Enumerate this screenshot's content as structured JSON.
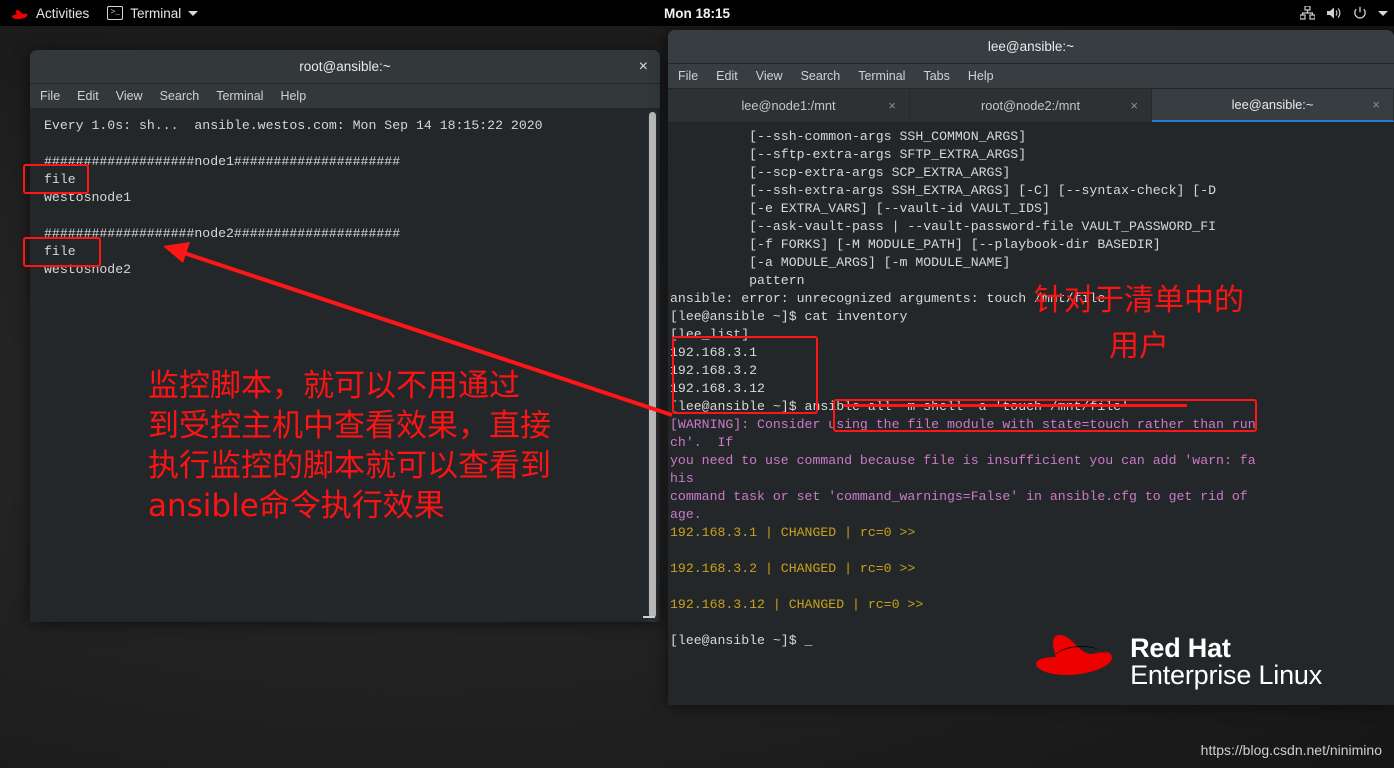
{
  "topbar": {
    "activities": "Activities",
    "app_menu": "Terminal",
    "clock": "Mon 18:15",
    "icons": [
      "redhat-logo-icon",
      "terminal-icon",
      "chevron-down-icon",
      "network-icon",
      "volume-icon",
      "power-icon",
      "system-menu-caret-icon"
    ]
  },
  "left_window": {
    "title": "root@ansible:~",
    "close_label": "×",
    "menu": [
      "File",
      "Edit",
      "View",
      "Search",
      "Terminal",
      "Help"
    ],
    "lines": [
      "Every 1.0s: sh...  ansible.westos.com: Mon Sep 14 18:15:22 2020",
      "",
      "###################node1#####################",
      "file",
      "westosnode1",
      "",
      "###################node2#####################",
      "file",
      "westosnode2"
    ],
    "annotation_boxes": [
      "file-node1-box",
      "file-node2-box"
    ]
  },
  "right_window": {
    "title": "lee@ansible:~",
    "menu": [
      "File",
      "Edit",
      "View",
      "Search",
      "Terminal",
      "Tabs",
      "Help"
    ],
    "tabs": [
      {
        "label": "lee@node1:/mnt",
        "close": "×",
        "active": false
      },
      {
        "label": "root@node2:/mnt",
        "close": "×",
        "active": false
      },
      {
        "label": "lee@ansible:~",
        "close": "×",
        "active": true
      }
    ],
    "usage_lines": [
      "          [--ssh-common-args SSH_COMMON_ARGS]",
      "          [--sftp-extra-args SFTP_EXTRA_ARGS]",
      "          [--scp-extra-args SCP_EXTRA_ARGS]",
      "          [--ssh-extra-args SSH_EXTRA_ARGS] [-C] [--syntax-check] [-D",
      "          [-e EXTRA_VARS] [--vault-id VAULT_IDS]",
      "          [--ask-vault-pass | --vault-password-file VAULT_PASSWORD_FI",
      "          [-f FORKS] [-M MODULE_PATH] [--playbook-dir BASEDIR]",
      "          [-a MODULE_ARGS] [-m MODULE_NAME]",
      "          pattern"
    ],
    "error_line": "ansible: error: unrecognized arguments: touch /mnt/file",
    "prompt_cat": "[lee@ansible ~]$ cat inventory",
    "inventory": [
      "[lee_list]",
      "192.168.3.1",
      "192.168.3.2",
      "192.168.3.12"
    ],
    "prompt_cmd_prefix": "[lee@ansible ~]$ ",
    "command": "ansible all -m shell -a 'touch /mnt/file'",
    "warning_lines": [
      "[WARNING]: Consider using the file module with state=touch rather than run",
      "ch'.  If",
      "you need to use command because file is insufficient you can add 'warn: fa",
      "his",
      "command task or set 'command_warnings=False' in ansible.cfg to get rid of",
      "age."
    ],
    "results": [
      "192.168.3.1 | CHANGED | rc=0 >>",
      "192.168.3.2 | CHANGED | rc=0 >>",
      "192.168.3.12 | CHANGED | rc=0 >>"
    ],
    "final_prompt": "[lee@ansible ~]$ _"
  },
  "annotations": {
    "left_text": "监控脚本，就可以不用通过\n到受控主机中查看效果，直接\n执行监控的脚本就可以查看到\nansible命令执行效果",
    "right_text": "针对于清单中的\n用户",
    "color": "#fc1414"
  },
  "branding": {
    "line1": "Red Hat",
    "line2": "Enterprise Linux",
    "watermark": "https://blog.csdn.net/ninimino",
    "accent": "#ee0000"
  }
}
